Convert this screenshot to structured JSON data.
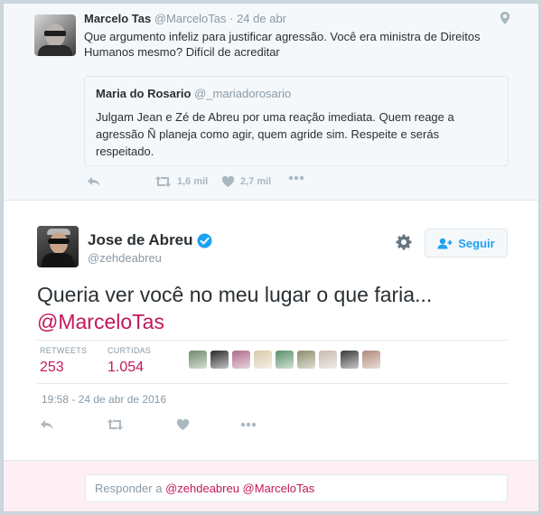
{
  "reply_tweet": {
    "author_name": "Marcelo Tas",
    "author_handle": "@MarceloTas",
    "separator": "·",
    "time": "24 de abr",
    "text": "Que argumento infeliz para justificar agressão. Você era ministra de Direitos Humanos mesmo? Difícil de acreditar",
    "quoted": {
      "author_name": "Maria do Rosario",
      "author_handle": "@_mariadorosario",
      "text": "Julgam Jean e Zé de Abreu por uma reação imediata. Quem reage a agressão Ñ planeja como agir, quem agride sim. Respeite e serás respeitado."
    },
    "retweets": "1,6 mil",
    "likes": "2,7 mil"
  },
  "main_tweet": {
    "author_name": "Jose de Abreu",
    "author_handle": "@zehdeabreu",
    "verified": true,
    "follow_label": "Seguir",
    "text_line1": "Queria ver você no meu lugar o que faria...",
    "text_line2": "@MarceloTas",
    "stats": {
      "retweets_label": "RETWEETS",
      "retweets_value": "253",
      "likes_label": "CURTIDAS",
      "likes_value": "1.054"
    },
    "likers_colors": [
      "#6f8a6a",
      "#2a2a2a",
      "#b06a8a",
      "#d9c9a8",
      "#5a8f6a",
      "#8c8c6a",
      "#c9b8b0",
      "#3a3a3a",
      "#b08a7a"
    ],
    "timestamp": "19:58 - 24 de abr de 2016"
  },
  "reply_box": {
    "prefix": "Responder a",
    "mentions": "@zehdeabreu @MarceloTas"
  },
  "colors": {
    "accent_link": "#c2185b",
    "follow_blue": "#1da1f2",
    "muted": "#8899a6",
    "icon_gray": "#aab8c2",
    "verified": "#1da1f2"
  }
}
